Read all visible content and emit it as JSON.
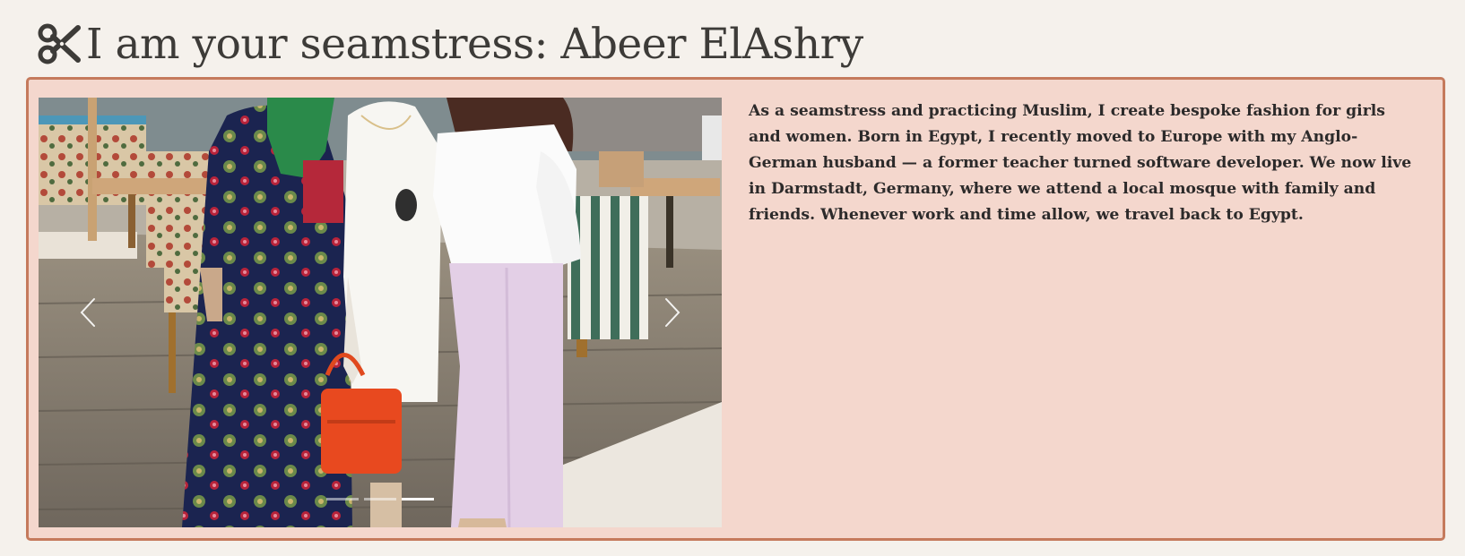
{
  "header": {
    "title": "I am your seamstress: Abeer ElAshry",
    "icon": "scissors-icon"
  },
  "about": {
    "bio": "As a seamstress and practicing Muslim, I create bespoke fashion for girls and women. Born in Egypt, I recently moved to Europe with my Anglo-German husband — a former teacher turned software developer. We now live in Darmstadt, Germany, where we attend a local mosque with family and friends. Whenever work and time allow, we travel back to Egypt."
  },
  "carousel": {
    "slide_count": 3,
    "active_slide": 3,
    "prev_icon": "chevron-left-icon",
    "next_icon": "chevron-right-icon"
  },
  "colors": {
    "page_background": "#f5f1ec",
    "card_background": "#f4d7cd",
    "card_border": "#c57a5c",
    "text": "#2c2a2a"
  }
}
